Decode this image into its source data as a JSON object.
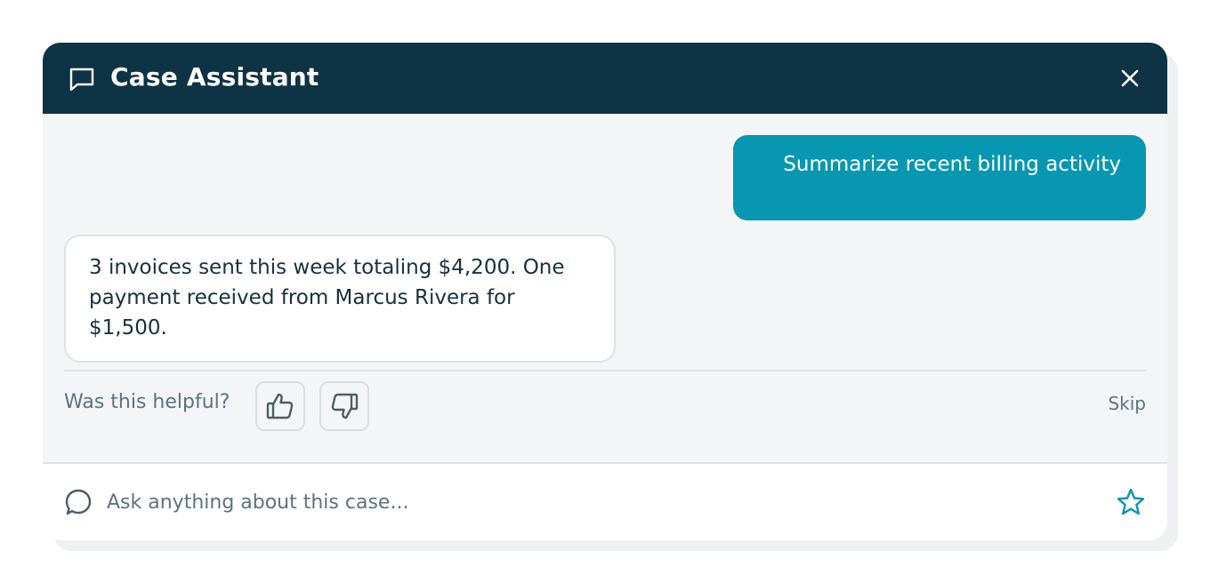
{
  "header": {
    "title": "Case Assistant",
    "icon": "chat-icon",
    "close_icon": "close-icon",
    "background_color": "#0e3345"
  },
  "conversation": {
    "user_message": "Summarize recent billing activity",
    "assistant_message": "3 invoices sent this week totaling $4,200. One payment received from Marcus Rivera for $1,500."
  },
  "feedback": {
    "question": "Was this helpful?",
    "thumbs_up_icon": "thumbs-up-icon",
    "thumbs_down_icon": "thumbs-down-icon",
    "skip_label": "Skip"
  },
  "input": {
    "placeholder": "Ask anything about this case...",
    "value": "",
    "left_icon": "message-circle-icon",
    "right_icon": "star-icon"
  },
  "colors": {
    "accent": "#0797b1",
    "header": "#0e3345",
    "text_primary": "#17303f",
    "text_muted": "#5e7280"
  }
}
